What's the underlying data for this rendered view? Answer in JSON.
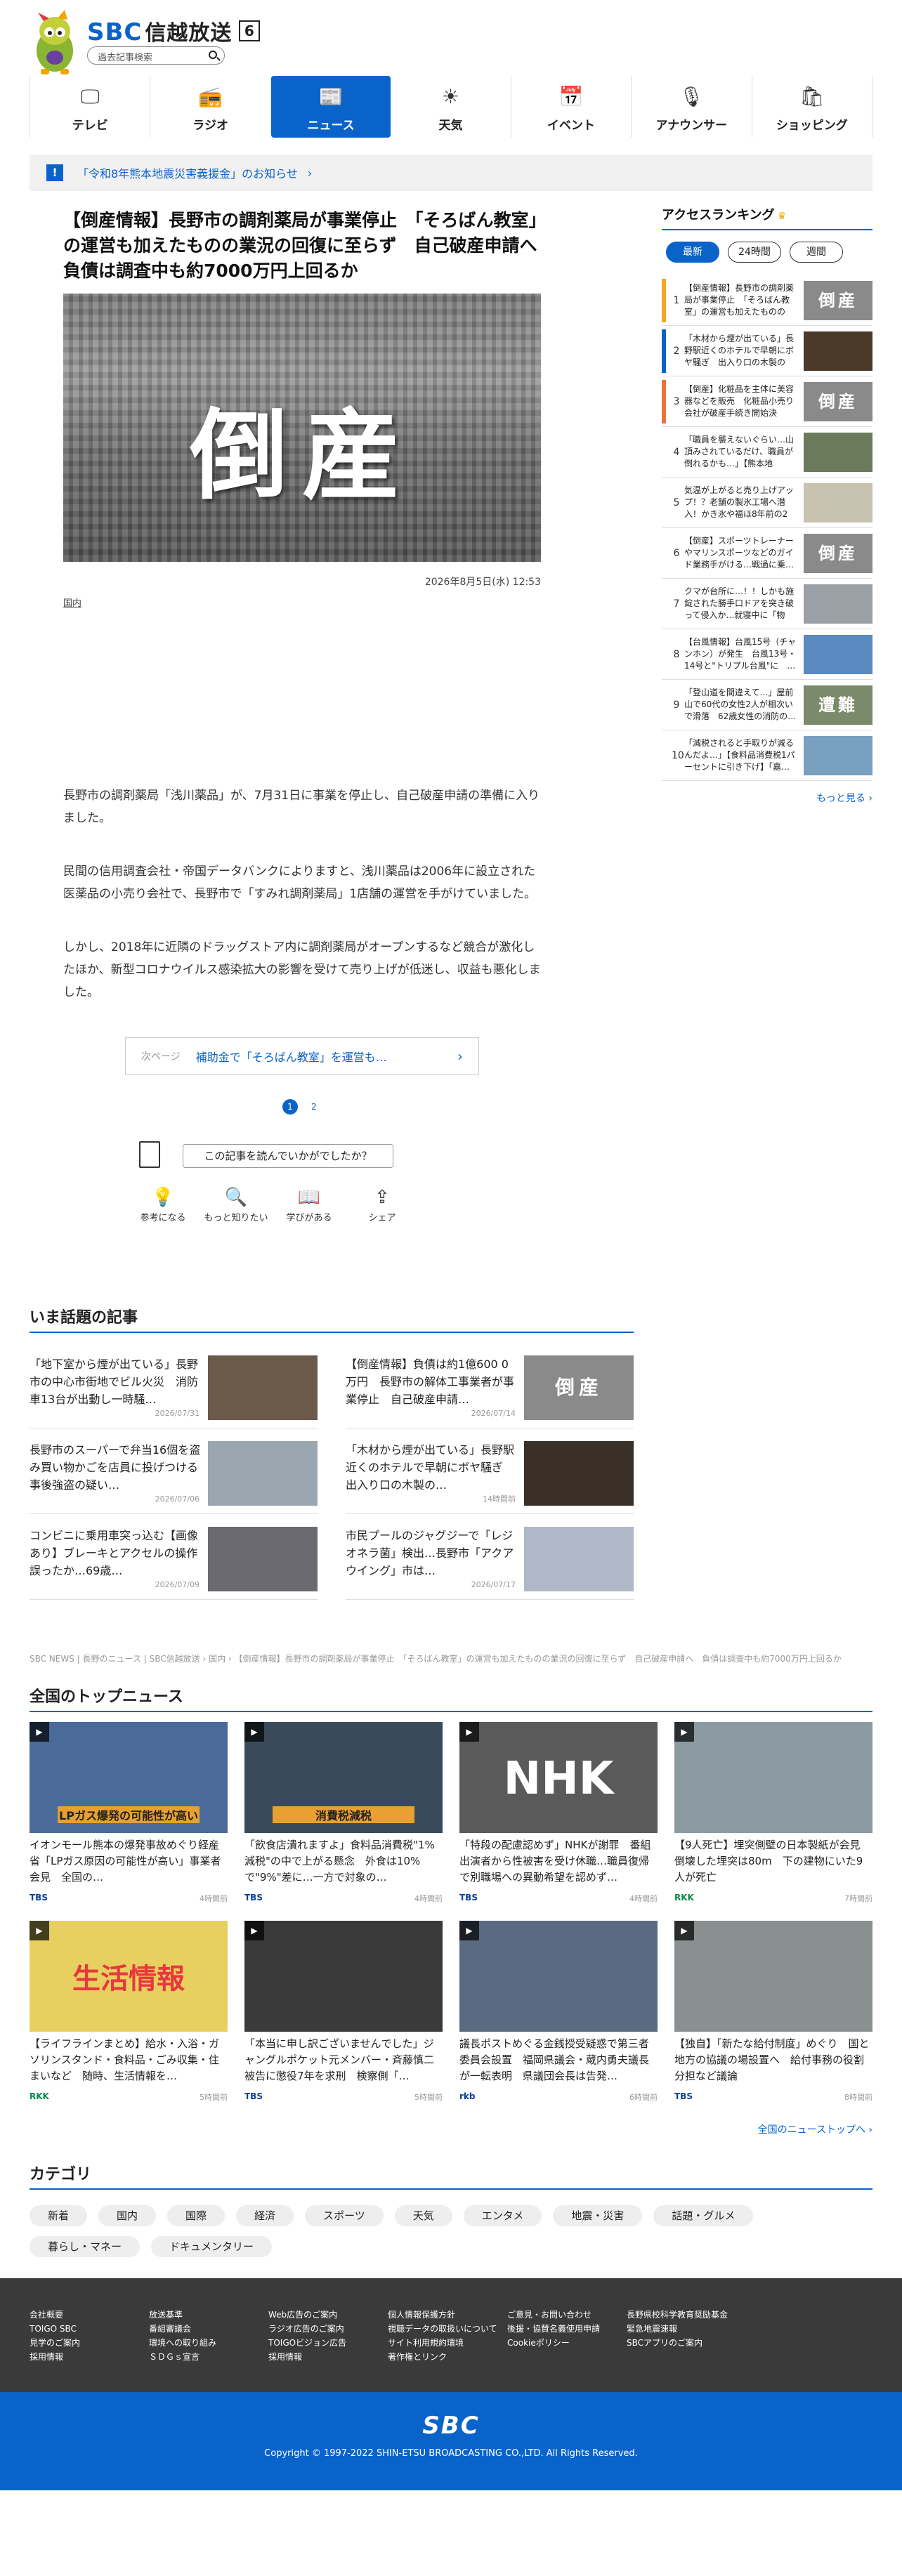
{
  "header": {
    "logo_sbc": "SBC",
    "logo_jp": "信越放送",
    "channel": "6",
    "search_placeholder": "過去記事検索"
  },
  "nav": [
    {
      "icon": "tv-icon",
      "glyph": "🖵",
      "label": "テレビ"
    },
    {
      "icon": "radio-icon",
      "glyph": "📻",
      "label": "ラジオ"
    },
    {
      "icon": "news-icon",
      "glyph": "📰",
      "label": "ニュース"
    },
    {
      "icon": "weather-icon",
      "glyph": "☀",
      "label": "天気"
    },
    {
      "icon": "calendar-icon",
      "glyph": "📅",
      "label": "イベント"
    },
    {
      "icon": "microphone-icon",
      "glyph": "🎙",
      "label": "アナウンサー"
    },
    {
      "icon": "shopping-bag-icon",
      "glyph": "🛍",
      "label": "ショッピング"
    }
  ],
  "notice": {
    "text": "「令和8年熊本地震災害義援金」のお知らせ"
  },
  "article": {
    "title": "【倒産情報】長野市の調剤薬局が事業停止　「そろばん教室」の運営も加えたものの業況の回復に至らず　自己破産申請へ　負債は調査中も約7000万円上回るか",
    "image_text": "倒産",
    "date": "2026年8月5日(水) 12:53",
    "category": "国内",
    "paragraphs": [
      "長野市の調剤薬局「浅川薬品」が、7月31日に事業を停止し、自己破産申請の準備に入りました。",
      "民間の信用調査会社・帝国データバンクによりますと、浅川薬品は2006年に設立された医薬品の小売り会社で、長野市で「すみれ調剤薬局」1店舗の運営を手がけていました。",
      "しかし、2018年に近隣のドラッグストア内に調剤薬局がオープンするなど競合が激化したほか、新型コロナウイルス感染拡大の影響を受けて売り上げが低迷し、収益も悪化しました。"
    ],
    "next_label": "次ページ",
    "next_title": "補助金で「そろばん教室」を運営も…",
    "pages": [
      "1",
      "2"
    ]
  },
  "feedback": {
    "question": "この記事を読んでいかがでしたか？",
    "items": [
      {
        "icon": "lightbulb-icon",
        "glyph": "💡",
        "label": "参考になる"
      },
      {
        "icon": "search-icon",
        "glyph": "🔍",
        "label": "もっと知りたい"
      },
      {
        "icon": "book-icon",
        "glyph": "📖",
        "label": "学びがある"
      },
      {
        "icon": "share-icon",
        "glyph": "⇪",
        "label": "シェア"
      }
    ]
  },
  "ranking": {
    "title": "アクセスランキング",
    "tabs": [
      "最新",
      "24時間",
      "週間"
    ],
    "more": "もっと見る ›",
    "colors": [
      "#f5a623",
      "#0a63c9",
      "#e8733d"
    ],
    "items": [
      {
        "num": "1",
        "text": "【倒産情報】長野市の調剤薬局が事業停止　「そろばん教室」の運営も加えたものの業…",
        "thumb": "倒産"
      },
      {
        "num": "2",
        "text": "「木材から煙が出ている」長野駅近くのホテルで早朝にボヤ騒ぎ　出入り口の木製の扉…",
        "thumb": ""
      },
      {
        "num": "3",
        "text": "【倒産】化粧品を主体に美容器などを販売　化粧品小売り会社が破産手続き開始決定　…",
        "thumb": "倒産"
      },
      {
        "num": "4",
        "text": "「職員を襲えないぐらい…山頂みされているだけ、職員が倒れるかも…」【熊本地震】…",
        "thumb": ""
      },
      {
        "num": "5",
        "text": "気温が上がると売り上げアップ！？老舗の製氷工場へ潜入！かき氷や福ほ8年前の2回…",
        "thumb": ""
      },
      {
        "num": "6",
        "text": "【倒産】スポーツトレーナーやマリンスポーツなどのガイド業務手がける…戦過に乗…",
        "thumb": "倒産"
      },
      {
        "num": "7",
        "text": "クマが台所に…！！しかも施錠された勝手口ドアを突き破って侵入か…就寝中に「物音…",
        "thumb": ""
      },
      {
        "num": "8",
        "text": "【台風情報】台風15号（チャンホン）が発生　台風13号・14号と\"トリプル台風\"に　…",
        "thumb": ""
      },
      {
        "num": "9",
        "text": "「登山道を間違えて…」屋前山で60代の女性2人が相次いで滑落　62歳女性の消防の…",
        "thumb": "遭難"
      },
      {
        "num": "10",
        "text": "「減税されると手取りが減るんだよ…」【食料品消費税1パーセントに引き下げ】「嘉…",
        "thumb": ""
      }
    ]
  },
  "topic": {
    "title": "いま話題の記事",
    "items": [
      {
        "text": "「地下室から煙が出ている」長野市の中心市街地でビル火災　消防車13台が出動し一時騒…",
        "date": "2026/07/31",
        "thumb": ""
      },
      {
        "text": "【倒産情報】負債は約1億600 0万円　長野市の解体工事業者が事業停止　自己破産申請…",
        "date": "2026/07/14",
        "thumb": "倒産"
      },
      {
        "text": "長野市のスーパーで弁当16個を盗み買い物かごを店員に投げつける　事後強盗の疑い…",
        "date": "2026/07/06",
        "thumb": ""
      },
      {
        "text": "「木材から煙が出ている」長野駅近くのホテルで早朝にボヤ騒ぎ　出入り口の木製の…",
        "date": "14時間前",
        "thumb": ""
      },
      {
        "text": "コンビニに乗用車突っ込む【画像あり】ブレーキとアクセルの操作誤ったか…69歳…",
        "date": "2026/07/09",
        "thumb": ""
      },
      {
        "text": "市民プールのジャグジーで「レジオネラ菌」検出…長野市「アクアウイング」市は…",
        "date": "2026/07/17",
        "thumb": ""
      }
    ]
  },
  "breadcrumb": "SBC NEWS | 長野のニュース | SBC信越放送 › 国内 › 【倒産情報】長野市の調剤薬局が事業停止　「そろばん教室」の運営も加えたものの業況の回復に至らず　自己破産申請へ　負債は調査中も約7000万円上回るか",
  "national": {
    "title": "全国のトップニュース",
    "more": "全国のニューストップへ ›",
    "items": [
      {
        "text": "イオンモール熊本の爆発事故めぐり経産省「LPガス原因の可能性が高い」事業者会見　全国の…",
        "src": "TBS",
        "time": "4時間前",
        "thumb": "LPガス爆発の可能性が高い"
      },
      {
        "text": "「飲食店潰れますよ」食料品消費税\"1%減税\"の中で上がる懸念　外食は10%で\"9%\"差に…一方で対象の…",
        "src": "TBS",
        "time": "4時間前",
        "thumb": "消費税減税"
      },
      {
        "text": "「特段の配慮認めず」NHKが謝罪　番組出演者から性被害を受け休職…職員復帰で別職場への異動希望を認めず…",
        "src": "TBS",
        "time": "4時間前",
        "thumb": "NHK"
      },
      {
        "text": "【9人死亡】埋突側壁の日本製紙が会見　倒壊した埋突は80m　下の建物にいた9人が死亡",
        "src": "RKK",
        "time": "7時間前",
        "thumb": ""
      },
      {
        "text": "【ライフラインまとめ】給水・入浴・ガソリンスタンド・食料品・ごみ収集・住まいなど　随時、生活情報を…",
        "src": "RKK",
        "time": "5時間前",
        "thumb": "生活情報"
      },
      {
        "text": "「本当に申し訳ございませんでした」ジャングルポケット元メンバー・斉藤慎二被告に懲役7年を求刑　検察側「…",
        "src": "TBS",
        "time": "5時間前",
        "thumb": ""
      },
      {
        "text": "議長ポストめぐる金銭授受疑惑で第三者委員会設置　福岡県議会・蔵内勇夫議長が一転表明　県議団会長は告発…",
        "src": "rkb",
        "time": "6時間前",
        "thumb": ""
      },
      {
        "text": "【独自】「新たな給付制度」めぐり　国と地方の協議の場設置へ　給付事務の役割分担など議論",
        "src": "TBS",
        "time": "8時間前",
        "thumb": ""
      }
    ]
  },
  "categories": {
    "title": "カテゴリ",
    "items": [
      "新着",
      "国内",
      "国際",
      "経済",
      "スポーツ",
      "天気",
      "エンタメ",
      "地震・災害",
      "話題・グルメ",
      "暮らし・マネー",
      "ドキュメンタリー"
    ]
  },
  "footer": {
    "cols": [
      [
        "会社概要",
        "TOIGO SBC",
        "見学のご案内",
        "採用情報"
      ],
      [
        "放送基準",
        "番組審議会",
        "環境への取り組み",
        "ＳＤＧｓ宣言"
      ],
      [
        "Web広告のご案内",
        "ラジオ広告のご案内",
        "TOIGOビジョン広告",
        "採用情報"
      ],
      [
        "個人情報保護方針",
        "視聴データの取扱いについて",
        "サイト利用規約環境",
        "著作権とリンク"
      ],
      [
        "ご意見・お問い合わせ",
        "後援・協賛名義使用申請",
        "Cookieポリシー"
      ],
      [
        "長野県校科学教育奨励基金",
        "緊急地震速報",
        "SBCアプリのご案内"
      ]
    ],
    "logo": "SBC",
    "copyright": "Copyright © 1997-2022 SHIN-ETSU BROADCASTING CO.,LTD. All Rights Reserved."
  }
}
